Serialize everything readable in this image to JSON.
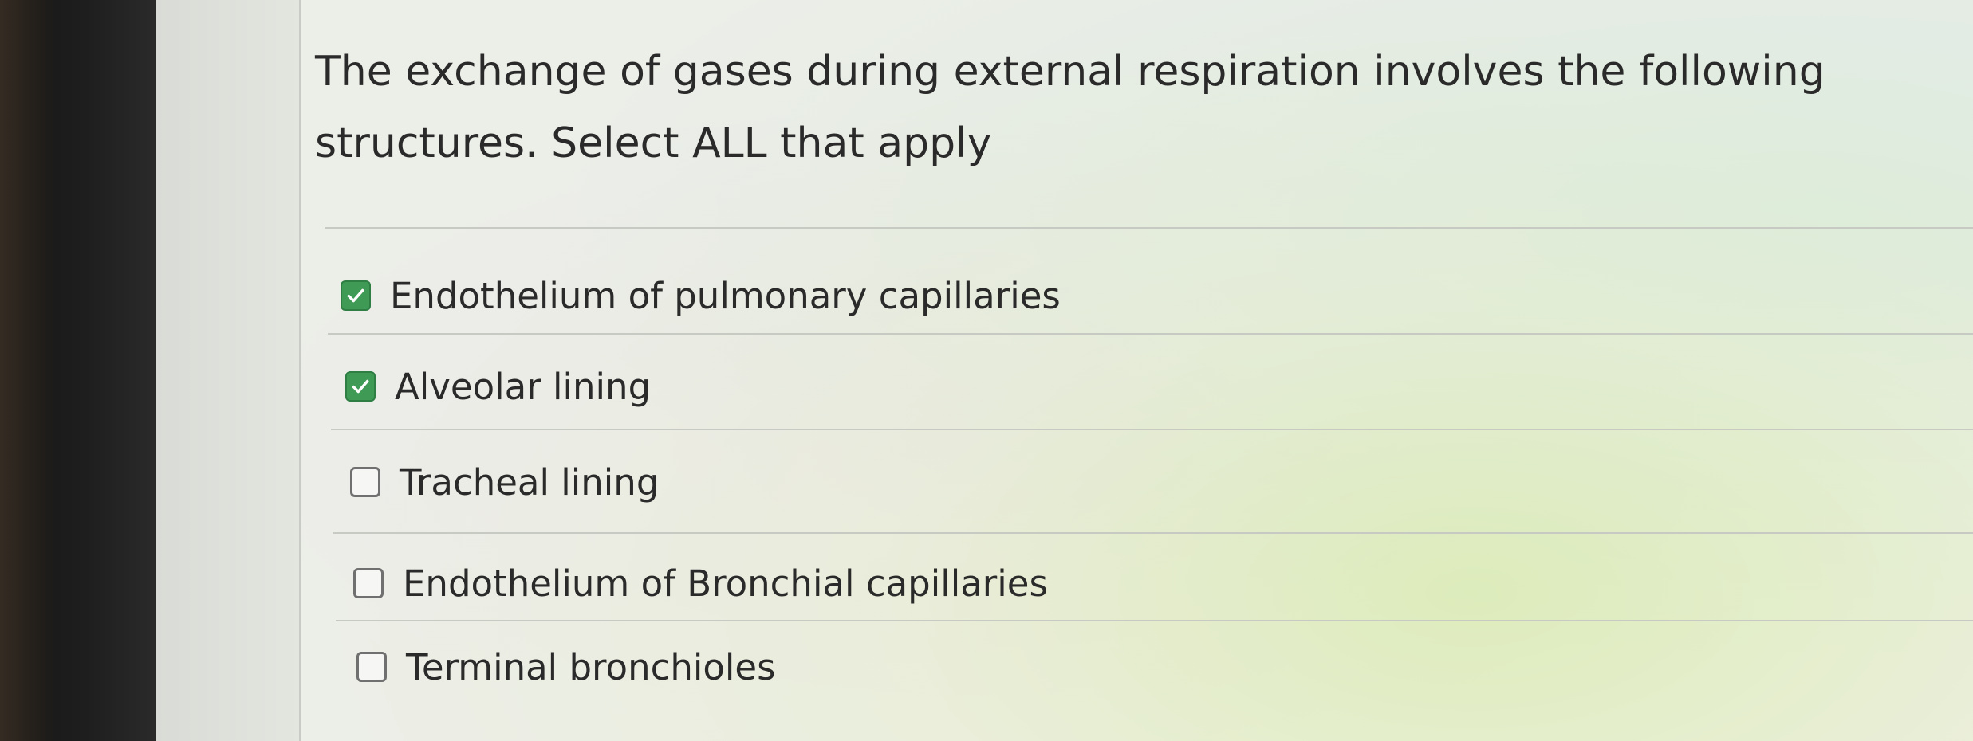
{
  "question": {
    "line1": "The exchange of gases during external respiration involves the following",
    "line2": "structures. Select ALL that apply"
  },
  "options": [
    {
      "label": "Endothelium of pulmonary capillaries",
      "checked": true
    },
    {
      "label": "Alveolar lining",
      "checked": true
    },
    {
      "label": "Tracheal lining",
      "checked": false
    },
    {
      "label": "Endothelium of Bronchial capillaries",
      "checked": false
    },
    {
      "label": "Terminal bronchioles",
      "checked": false
    }
  ],
  "colors": {
    "checked_fill": "#3f9a55",
    "unchecked_border": "#707070",
    "text": "#2a2a2a"
  },
  "icons": {
    "checked": "check-icon"
  }
}
